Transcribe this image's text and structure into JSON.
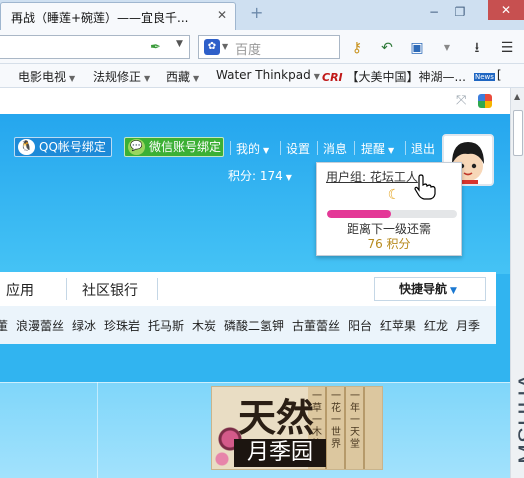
{
  "browser": {
    "tab_title": "再战（睡莲+碗莲）——宜良千...",
    "tab_close": "✕",
    "new_tab": "+",
    "search_placeholder": "百度",
    "bookmarks": [
      {
        "label": "电影电视",
        "caret": "▼"
      },
      {
        "label": "法规修正",
        "caret": "▼"
      },
      {
        "label": "西藏",
        "caret": "▼"
      },
      {
        "label": "Water Thinkpad",
        "caret": "▼"
      },
      {
        "badge": "CRI",
        "label": "【大美中国】神湖—..."
      },
      {
        "badge": "News",
        "label": "["
      }
    ]
  },
  "header": {
    "qq_bind": "QQ帐号绑定",
    "wechat_bind": "微信账号绑定",
    "nav": [
      {
        "label": "我的",
        "caret": "▼"
      },
      {
        "label": "设置"
      },
      {
        "label": "消息"
      },
      {
        "label": "提醒",
        "caret": "▼"
      },
      {
        "label": "退出"
      }
    ],
    "points_label": "积分: 174",
    "points_caret": "▼"
  },
  "popup": {
    "user_group": "用户组: 花坛工人",
    "next_level": "距离下一级还需",
    "points_needed": "76 积分",
    "progress_fraction": 0.49,
    "progress_color": "#e43897"
  },
  "main_nav": {
    "items": [
      "应用",
      "社区银行"
    ],
    "quick_nav": "快捷导航"
  },
  "tags": [
    "董",
    "浪漫蕾丝",
    "绿冰",
    "珍珠岩",
    "托马斯",
    "木炭",
    "磷酸二氢钾",
    "古董蕾丝",
    "阳台",
    "红苹果",
    "红龙",
    "月季"
  ],
  "banner": {
    "top_text": "天然",
    "bottom_text": "月季园",
    "slat_texts": [
      "一草一木皆",
      "一花一世界",
      "一年一天堂"
    ]
  },
  "watermark": "MSHUA",
  "colors": {
    "header_blue": "#25a6ee",
    "qq_blue": "#1d8ad8",
    "wechat_green": "#3cb035",
    "points_gold": "#b78a1d"
  }
}
